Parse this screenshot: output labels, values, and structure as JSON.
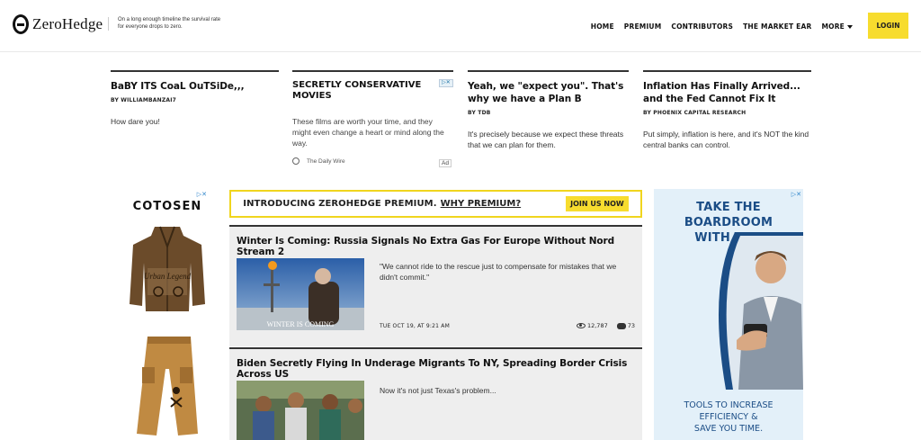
{
  "header": {
    "logo_text": "ZeroHedge",
    "tagline": "On a long enough timeline the survival rate for everyone drops to zero.",
    "nav": [
      "HOME",
      "PREMIUM",
      "CONTRIBUTORS",
      "THE MARKET EAR",
      "MORE"
    ],
    "login_label": "LOGIN"
  },
  "teasers": [
    {
      "title": "BaBY ITS CoaL OuTSiDe,,,",
      "byline": "BY WILLIAMBANZAI7",
      "excerpt": "How dare you!"
    },
    {
      "title": "Yeah, we \"expect you\". That's why we have a Plan B",
      "byline": "BY TDB",
      "excerpt": "It's precisely because we expect these threats that we can plan for them."
    },
    {
      "title": "Inflation Has Finally Arrived... and the Fed Cannot Fix It",
      "byline": "BY PHOENIX CAPITAL RESEARCH",
      "excerpt": "Put simply, inflation is here, and it's NOT the kind central banks can control."
    }
  ],
  "sponsored": {
    "title": "SECRETLY CONSERVATIVE MOVIES",
    "excerpt": "These films are worth your time, and they might even change a heart or mind along the way.",
    "source": "The Daily Wire",
    "ad_label": "Ad"
  },
  "left_ad": {
    "brand": "COTOSEN",
    "jacket_text": "Urban Legend"
  },
  "premium_banner": {
    "intro": "INTRODUCING ZEROHEDGE PREMIUM.",
    "why": "WHY PREMIUM?",
    "join": "JOIN US NOW"
  },
  "articles": [
    {
      "title": "Winter Is Coming: Russia Signals No Extra Gas For Europe Without Nord Stream 2",
      "excerpt": "\"We cannot ride to the rescue just to compensate for mistakes that we didn't commit.\"",
      "thumb_caption": "WINTER IS COMING",
      "date": "TUE OCT 19, AT 9:21 AM",
      "views": "12,787",
      "comments": "73"
    },
    {
      "title": "Biden Secretly Flying In Underage Migrants To NY, Spreading Border Crisis Across US",
      "excerpt": "Now it's not just Texas's problem..."
    }
  ],
  "right_ad": {
    "headline_lines": [
      "TAKE THE",
      "BOARDROOM",
      "WITH YOU"
    ],
    "tagline_lines": [
      "TOOLS TO INCREASE",
      "EFFICIENCY &",
      "SAVE YOU TIME."
    ]
  },
  "colors": {
    "accent_yellow": "#f7dc2e",
    "ad_blue": "#1b4d86"
  }
}
